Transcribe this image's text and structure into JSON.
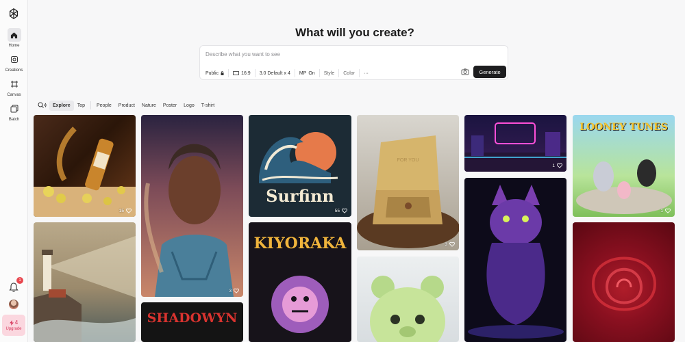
{
  "sidebar": {
    "items": [
      {
        "label": "Home",
        "icon": "home-icon"
      },
      {
        "label": "Creations",
        "icon": "creations-icon"
      },
      {
        "label": "Canvas",
        "icon": "canvas-icon"
      },
      {
        "label": "Batch",
        "icon": "batch-icon"
      }
    ],
    "notification_count": "1",
    "upgrade": {
      "count": "4",
      "label": "Upgrade"
    }
  },
  "header": {
    "title": "What will you create?"
  },
  "prompt": {
    "placeholder": "Describe what you want to see",
    "options": {
      "visibility": "Public",
      "ratio": "16:9",
      "model": "3.0 Default x 4",
      "mp_label": "MP",
      "mp_value": "On",
      "style": "Style",
      "color": "Color",
      "more": "···"
    },
    "generate_label": "Generate"
  },
  "filters": [
    "Explore",
    "Top",
    "People",
    "Product",
    "Nature",
    "Poster",
    "Logo",
    "T-shirt"
  ],
  "gallery": [
    {
      "id": "whisky",
      "likes": "15"
    },
    {
      "id": "woman",
      "likes": "3"
    },
    {
      "id": "surfinn",
      "likes": "55",
      "text": "Surfinn"
    },
    {
      "id": "gift-box",
      "likes": "3",
      "text": "FOR YOU"
    },
    {
      "id": "neon-arcade",
      "likes": "1"
    },
    {
      "id": "looney-tunes",
      "likes": "1",
      "text": "LOONEY TUNES"
    },
    {
      "id": "lighthouse"
    },
    {
      "id": "kiyoraka",
      "text": "KIYORAKA"
    },
    {
      "id": "jelly-bear"
    },
    {
      "id": "cat"
    },
    {
      "id": "rose"
    },
    {
      "id": "shadowyn",
      "text": "SHADOWYN"
    }
  ],
  "colors": {
    "accent": "#1d1d1f",
    "upgrade_bg": "#fbd7df",
    "upgrade_fg": "#d7375b",
    "badge": "#e8474f"
  }
}
